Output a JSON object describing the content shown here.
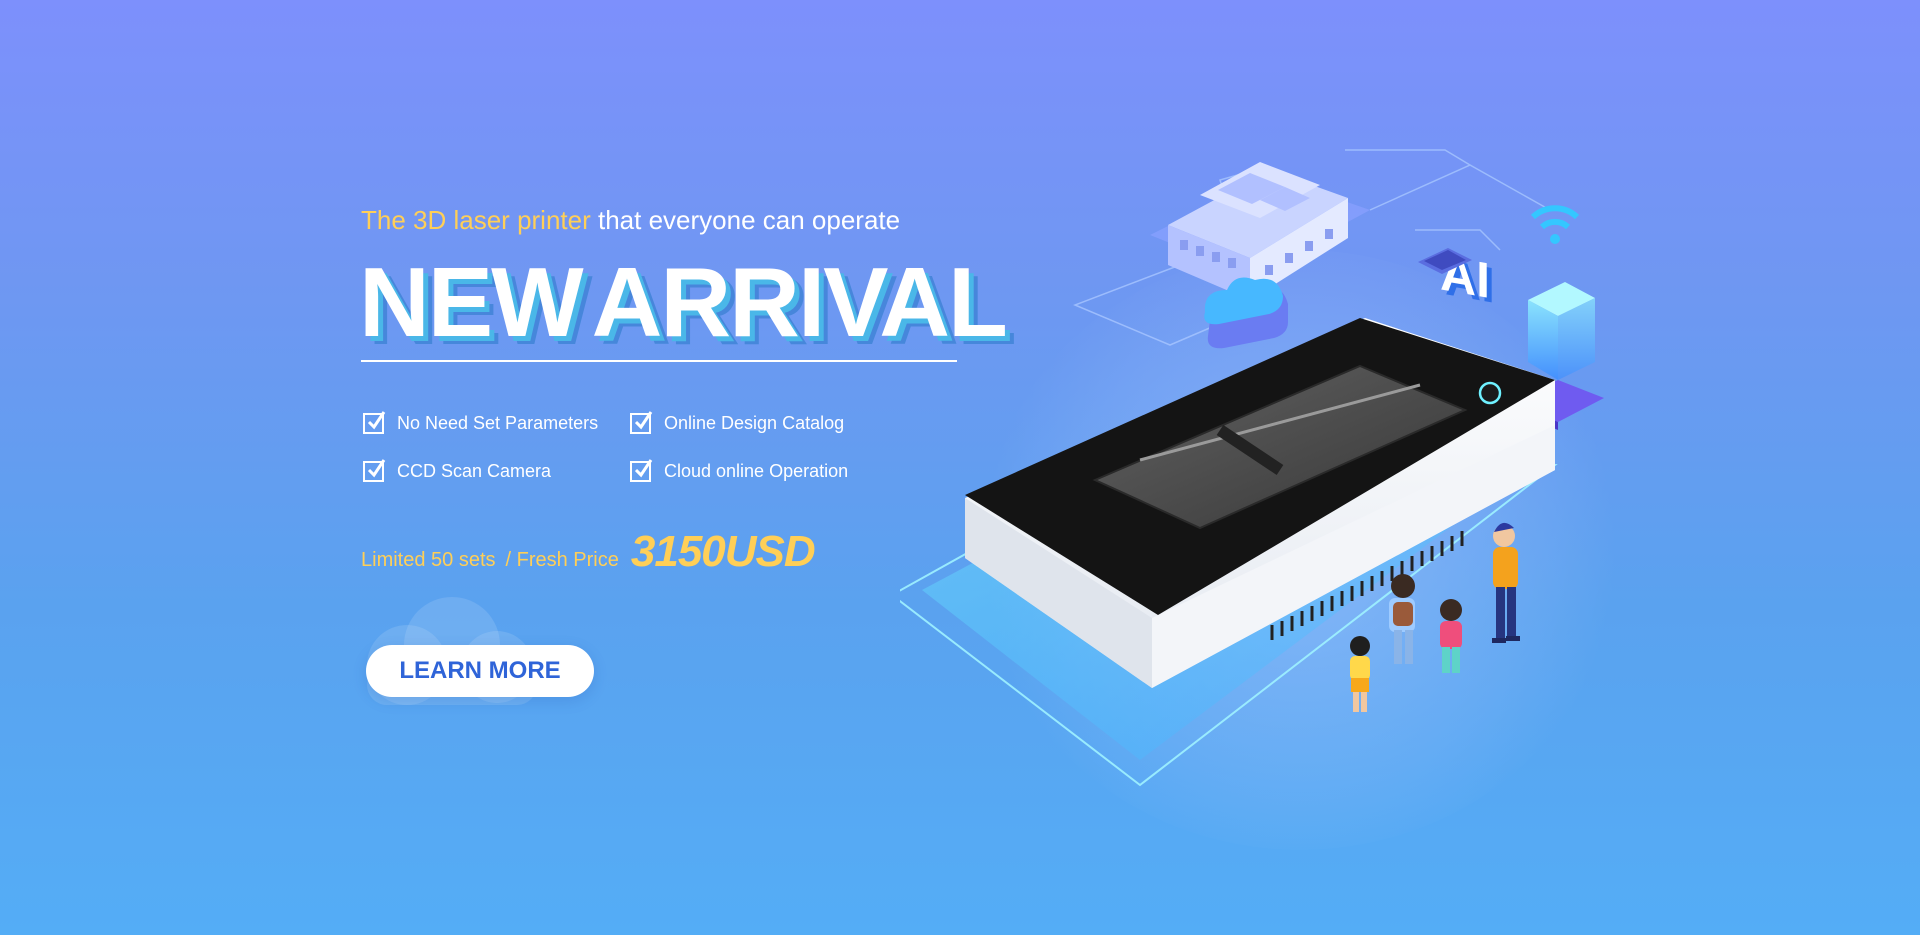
{
  "hero": {
    "tagline_accent": "The 3D laser printer",
    "tagline_rest": " that everyone can operate",
    "headline_word1": "NEW",
    "headline_word2": "ARRIVAL",
    "features": [
      "No Need Set Parameters",
      "Online Design Catalog",
      "CCD Scan Camera",
      "Cloud online Operation"
    ],
    "limited": "Limited 50 sets",
    "fresh": " / Fresh Price",
    "price": "3150USD",
    "cta_label": "LEARN MORE"
  },
  "illustration": {
    "badge_text": "AI",
    "icons": [
      "building-icon",
      "cloud-icon",
      "wifi-icon",
      "server-icon",
      "chip-icon"
    ]
  },
  "colors": {
    "accent_yellow": "#ffcf57",
    "button_text": "#2f64d8",
    "device_top": "#141414",
    "device_body": "#f4f6fa"
  }
}
